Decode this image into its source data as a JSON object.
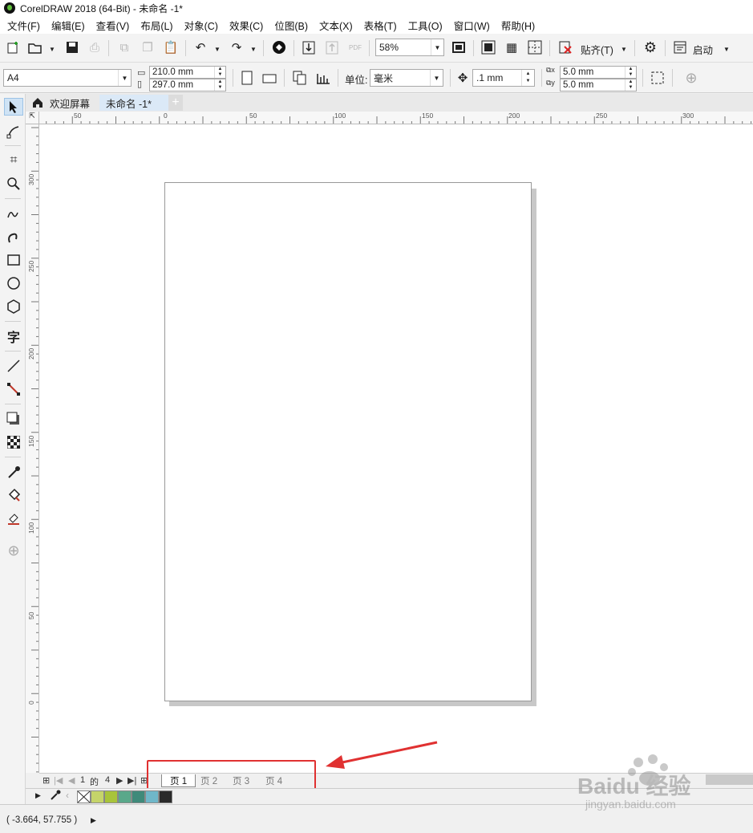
{
  "window": {
    "title": "CorelDRAW 2018 (64-Bit) - 未命名 -1*"
  },
  "menu": [
    "文件(F)",
    "编辑(E)",
    "查看(V)",
    "布局(L)",
    "对象(C)",
    "效果(C)",
    "位图(B)",
    "文本(X)",
    "表格(T)",
    "工具(O)",
    "窗口(W)",
    "帮助(H)"
  ],
  "toolbar": {
    "zoom": "58%",
    "pdf_label": "PDF",
    "snap_label": "贴齐(T)",
    "launch_label": "启动"
  },
  "property_bar": {
    "page_size": "A4",
    "width": "210.0 mm",
    "height": "297.0 mm",
    "units_label": "单位:",
    "units_value": "毫米",
    "nudge": ".1 mm",
    "dup_x": "5.0 mm",
    "dup_y": "5.0 mm"
  },
  "doc_tabs": {
    "welcome": "欢迎屏幕",
    "current": "未命名 -1*"
  },
  "ruler_h_labels": [
    "50",
    "0",
    "50",
    "100",
    "150",
    "200",
    "250",
    "300"
  ],
  "ruler_v_labels": [
    "300",
    "250",
    "200",
    "150",
    "100",
    "50",
    "0"
  ],
  "page_nav": {
    "current": "1",
    "of": "的",
    "total": "4",
    "pages": [
      "页 1",
      "页 2",
      "页 3",
      "页 4"
    ]
  },
  "palette_colors": [
    "#c5d46a",
    "#a8c43a",
    "#5aa88a",
    "#3f8a7a",
    "#6fb7c9",
    "#2a2a2a"
  ],
  "status": {
    "coords": "( -3.664, 57.755 )"
  },
  "watermark": {
    "brand": "Baidu 经验",
    "url": "jingyan.baidu.com"
  },
  "colors": {
    "highlight": "#e03131",
    "active_tab": "#dbe9f7"
  }
}
